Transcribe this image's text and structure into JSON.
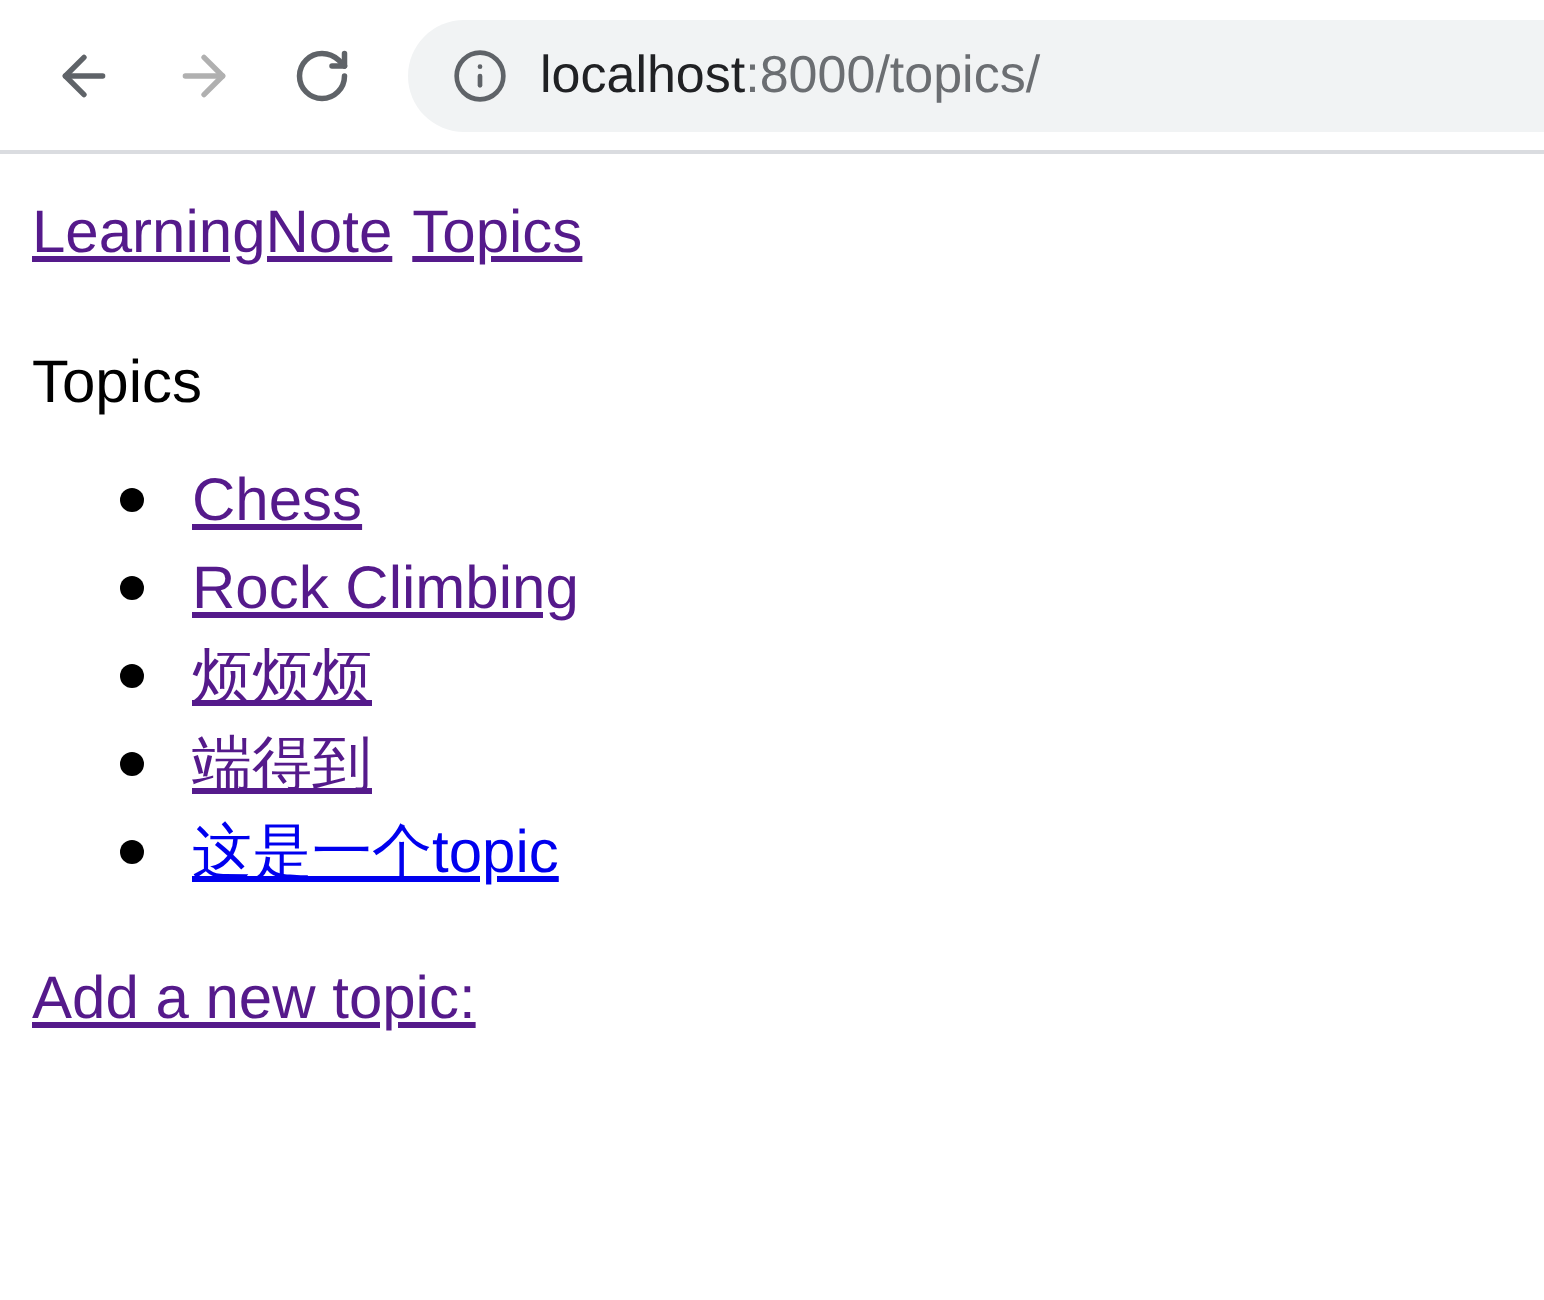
{
  "browser": {
    "back_disabled": false,
    "forward_disabled": true,
    "address": {
      "host": "localhost",
      "path": ":8000/topics/"
    }
  },
  "nav_links": [
    {
      "label": "LearningNote",
      "visited": true
    },
    {
      "label": "Topics",
      "visited": true
    }
  ],
  "heading": "Topics",
  "topics": [
    {
      "label": "Chess",
      "visited": true
    },
    {
      "label": "Rock Climbing",
      "visited": true
    },
    {
      "label": "烦烦烦",
      "visited": true
    },
    {
      "label": "端得到",
      "visited": true
    },
    {
      "label": "这是一个topic",
      "visited": false
    }
  ],
  "add_link": {
    "label": "Add a new topic:",
    "visited": true
  }
}
